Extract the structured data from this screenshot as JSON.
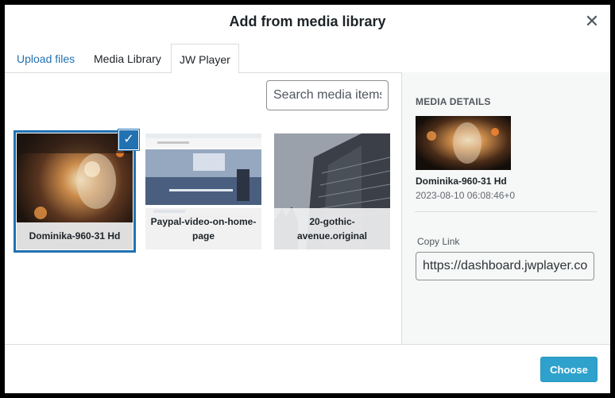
{
  "dialog": {
    "title": "Add from media library"
  },
  "tabs": [
    {
      "label": "Upload files"
    },
    {
      "label": "Media Library"
    },
    {
      "label": "JW Player"
    }
  ],
  "search": {
    "placeholder": "Search media items"
  },
  "media_items": [
    {
      "caption": "Dominika-960-31 Hd",
      "selected": true
    },
    {
      "caption": "Paypal-video-on-home-page",
      "selected": false
    },
    {
      "caption": "20-gothic-avenue.original",
      "selected": false
    }
  ],
  "details": {
    "heading": "MEDIA DETAILS",
    "name": "Dominika-960-31 Hd",
    "date": "2023-08-10 06:08:46+0",
    "copy_label": "Copy Link",
    "copy_value": "https://dashboard.jwplayer.com"
  },
  "footer": {
    "choose_label": "Choose"
  },
  "icons": {
    "close": "close-icon",
    "check": "checkmark-icon"
  },
  "colors": {
    "accent": "#2271b1",
    "button": "#2ea2cc"
  }
}
